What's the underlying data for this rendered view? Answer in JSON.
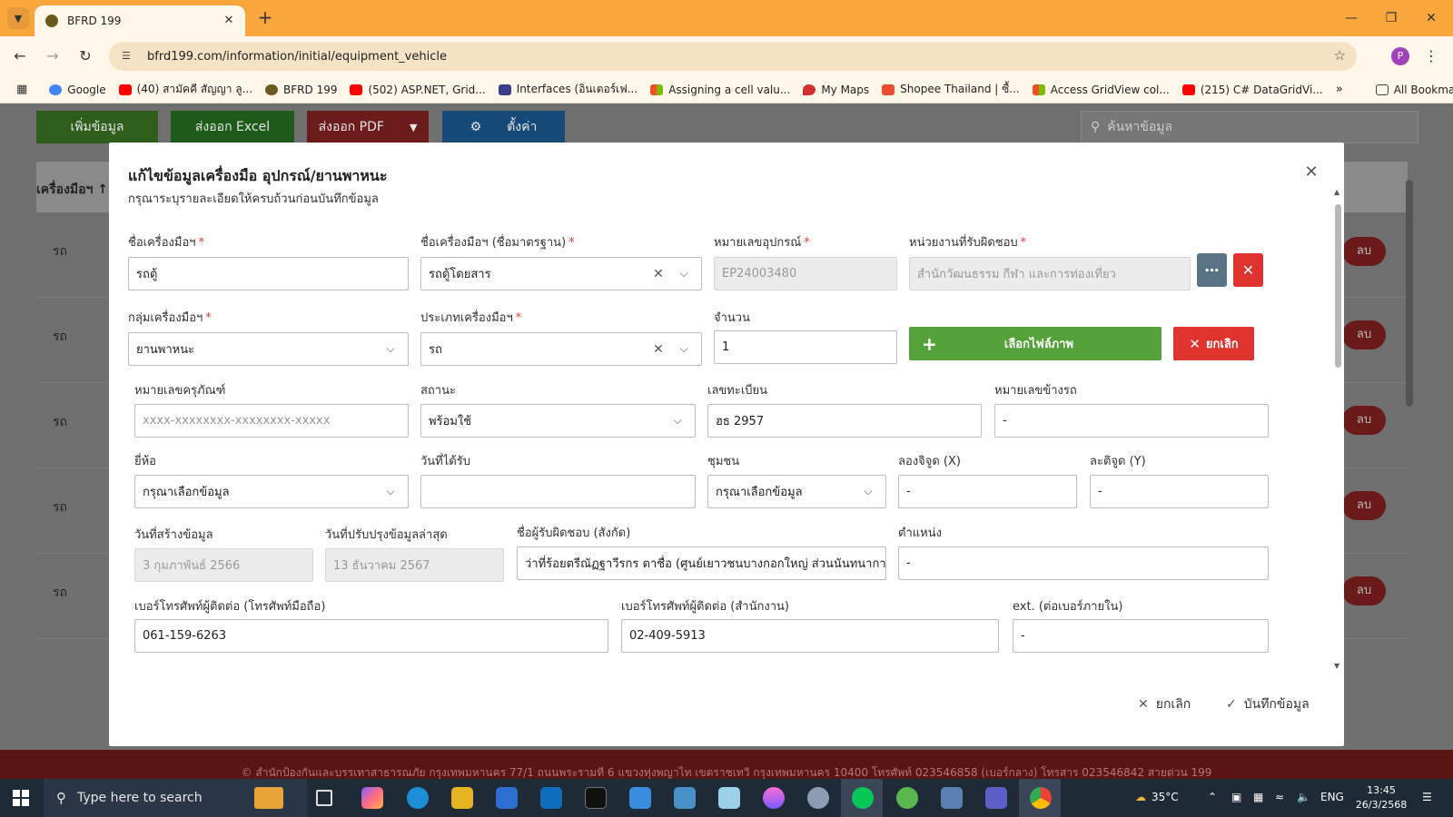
{
  "browser": {
    "tab_title": "BFRD 199",
    "url": "bfrd199.com/information/initial/equipment_vehicle",
    "profile_initial": "P",
    "bookmarks": [
      {
        "label": "Google",
        "color": "#4285f4"
      },
      {
        "label": "(40) สามัคคี สัญญา ลู...",
        "color": "#ff0000"
      },
      {
        "label": "BFRD 199",
        "color": "#6b5a1e"
      },
      {
        "label": "(502) ASP.NET, Grid...",
        "color": "#ff0000"
      },
      {
        "label": "Interfaces (อินเตอร์เฟ...",
        "color": "#3c3c8c"
      },
      {
        "label": "Assigning a cell valu...",
        "color": "#f25022"
      },
      {
        "label": "My Maps",
        "color": "#d32f2f"
      },
      {
        "label": "Shopee Thailand | ซื้...",
        "color": "#ee4d2d"
      },
      {
        "label": "Access GridView col...",
        "color": "#f25022"
      },
      {
        "label": "(215) C# DataGridVi...",
        "color": "#ff0000"
      }
    ],
    "all_bookmarks": "All Bookmarks"
  },
  "page": {
    "buttons": {
      "add": "เพิ่มข้อมูล",
      "export_excel": "ส่งออก Excel",
      "export_pdf": "ส่งออก PDF",
      "settings": "ตั้งค่า"
    },
    "search_placeholder": "ค้นหาข้อมูล",
    "table_header": "เครื่องมือฯ",
    "rows": [
      {
        "label": "รถ",
        "action": "ลบ"
      },
      {
        "label": "รถ",
        "action": "ลบ"
      },
      {
        "label": "รถ",
        "action": "ลบ"
      },
      {
        "label": "รถ",
        "action": "ลบ"
      },
      {
        "label": "รถ",
        "action": "ลบ"
      }
    ],
    "footer": "© สำนักป้องกันและบรรเทาสาธารณภัย กรุงเทพมหานคร 77/1 ถนนพระรามที่ 6 แขวงทุ่งพญาไท เขตราชเทวี กรุงเทพมหานคร 10400 โทรศัพท์ 023546858 (เบอร์กลาง) โทรสาร 023546842 สายด่วน 199"
  },
  "modal": {
    "title": "แก้ไขข้อมูลเครื่องมือ อุปกรณ์/ยานพาหนะ",
    "subtitle": "กรุณาระบุรายละเอียดให้ครบถ้วนก่อนบันทึกข้อมูล",
    "required_mark": "*",
    "fields": {
      "tool_name": {
        "label": "ชื่อเครื่องมือฯ",
        "value": "รถตู้"
      },
      "tool_std_name": {
        "label": "ชื่อเครื่องมือฯ (ชื่อมาตรฐาน)",
        "value": "รถตู้โดยสาร"
      },
      "equipment_no": {
        "label": "หมายเลขอุปกรณ์",
        "value": "EP24003480"
      },
      "department": {
        "label": "หน่วยงานที่รับผิดชอบ",
        "value": "สำนักวัฒนธรรม กีฬา และการท่องเที่ยว"
      },
      "tool_group": {
        "label": "กลุ่มเครื่องมือฯ",
        "value": "ยานพาหนะ"
      },
      "tool_type": {
        "label": "ประเภทเครื่องมือฯ",
        "value": "รถ"
      },
      "quantity": {
        "label": "จำนวน",
        "value": "1"
      },
      "asset_no": {
        "label": "หมายเลขครุภัณฑ์",
        "placeholder": "xxxx-xxxxxxxx-xxxxxxxx-xxxxx"
      },
      "status": {
        "label": "สถานะ",
        "value": "พร้อมใช้"
      },
      "plate_no": {
        "label": "เลขทะเบียน",
        "value": "ฮธ 2957"
      },
      "side_no": {
        "label": "หมายเลขข้างรถ",
        "value": "-"
      },
      "brand": {
        "label": "ยี่ห้อ",
        "value": "กรุณาเลือกข้อมูล"
      },
      "received_date": {
        "label": "วันที่ได้รับ",
        "value": ""
      },
      "community": {
        "label": "ชุมชน",
        "value": "กรุณาเลือกข้อมูล"
      },
      "longitude": {
        "label": "ลองจิจูด (X)",
        "value": "-"
      },
      "latitude": {
        "label": "ละติจูด (Y)",
        "value": "-"
      },
      "created_date": {
        "label": "วันที่สร้างข้อมูล",
        "value": "3 กุมภาพันธ์ 2566"
      },
      "updated_date": {
        "label": "วันที่ปรับปรุงข้อมูลล่าสุด",
        "value": "13 ธันวาคม 2567"
      },
      "responsible": {
        "label": "ชื่อผู้รับผิดชอบ (สังกัด)",
        "value": "ว่าที่ร้อยตรีณัฏฐาวีรกร ตาชื่อ (ศูนย์เยาวชนบางกอกใหญ่ ส่วนนันทนาการ"
      },
      "position": {
        "label": "ตำแหน่ง",
        "value": "-"
      },
      "mobile": {
        "label": "เบอร์โทรศัพท์ผู้ติดต่อ (โทรศัพท์มือถือ)",
        "value": "061-159-6263"
      },
      "office_phone": {
        "label": "เบอร์โทรศัพท์ผู้ติดต่อ (สำนักงาน)",
        "value": "02-409-5913"
      },
      "ext": {
        "label": "ext. (ต่อเบอร์ภายใน)",
        "value": "-"
      }
    },
    "image_select": "เลือกไฟล์ภาพ",
    "image_cancel": "ยกเลิก",
    "footer_cancel": "ยกเลิก",
    "footer_save": "บันทึกข้อมูล"
  },
  "taskbar": {
    "search_placeholder": "Type here to search",
    "weather": "35°C",
    "language": "ENG",
    "time": "13:45",
    "date": "26/3/2568"
  }
}
